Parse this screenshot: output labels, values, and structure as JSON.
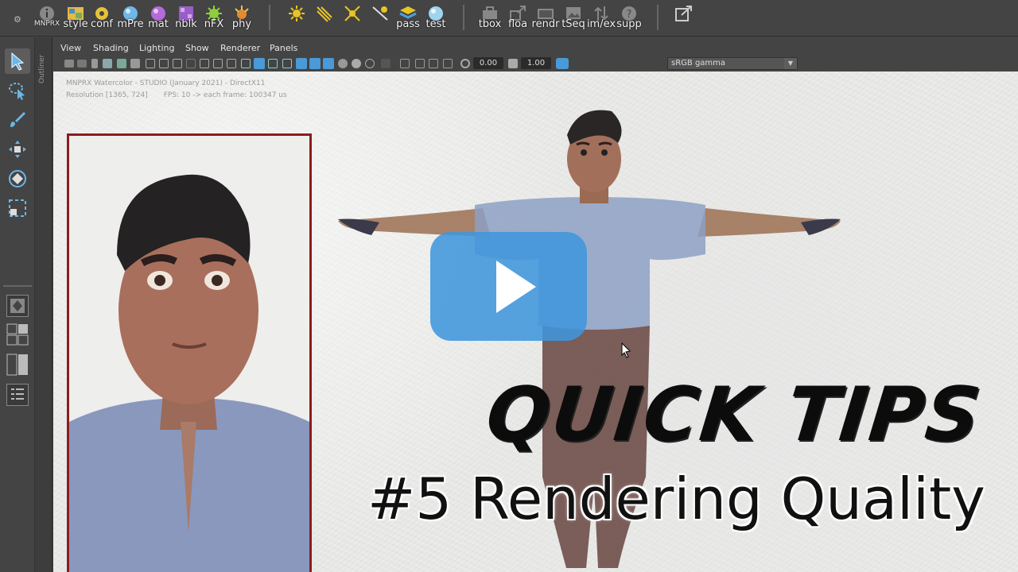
{
  "shelf": {
    "items": [
      {
        "label": "MNPRX",
        "icon": "info-icon"
      },
      {
        "label": "style",
        "icon": "palette-icon"
      },
      {
        "label": "conf",
        "icon": "config-icon"
      },
      {
        "label": "mPre",
        "icon": "material-preset-icon"
      },
      {
        "label": "mat",
        "icon": "material-icon"
      },
      {
        "label": "nblk",
        "icon": "noise-block-icon"
      },
      {
        "label": "nFX",
        "icon": "noise-fx-icon"
      },
      {
        "label": "phy",
        "icon": "physics-icon"
      },
      {
        "label": "",
        "icon": "light-icon"
      },
      {
        "label": "",
        "icon": "light-arrow-icon"
      },
      {
        "label": "",
        "icon": "light-cross-icon"
      },
      {
        "label": "",
        "icon": "light-pointer-icon"
      },
      {
        "label": "pass",
        "icon": "pass-layers-icon"
      },
      {
        "label": "test",
        "icon": "test-sphere-icon"
      },
      {
        "label": "tbox",
        "icon": "toolbox-icon"
      },
      {
        "label": "floa",
        "icon": "float-icon"
      },
      {
        "label": "rendr",
        "icon": "render-icon"
      },
      {
        "label": "tSeq",
        "icon": "image-sequence-icon"
      },
      {
        "label": "im/ex",
        "icon": "import-export-icon"
      },
      {
        "label": "supp",
        "icon": "support-icon"
      },
      {
        "label": "",
        "icon": "external-link-icon"
      }
    ]
  },
  "outliner": {
    "label": "Outliner"
  },
  "viewport_menu": [
    "View",
    "Shading",
    "Lighting",
    "Show",
    "Renderer",
    "Panels"
  ],
  "viewport_toolbar": {
    "exposure": "0.00",
    "gamma": "1.00",
    "color_space": "sRGB gamma"
  },
  "hud": {
    "line1": "MNPRX Watercolor - STUDIO (January 2021) - DirectX11",
    "line2": "Resolution [1365, 724]       FPS: 10 -> each frame: 100347 us"
  },
  "overlay": {
    "title": "QUICK TIPS",
    "subtitle": "#5 Rendering Quality"
  },
  "colors": {
    "inset_border": "#8b1d1d",
    "play_button": "#4096dc"
  }
}
